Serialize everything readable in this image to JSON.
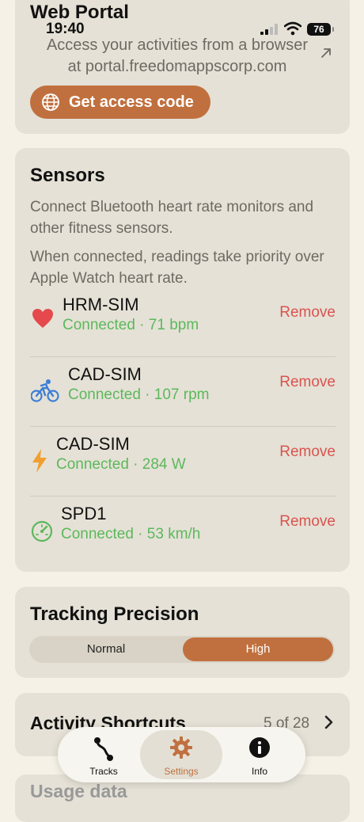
{
  "status_bar": {
    "time": "19:40",
    "battery": "76"
  },
  "web_portal": {
    "title": "Web Portal",
    "description_line1": "Access your activities from a browser",
    "description_line2": "at portal.freedomappscorp.com",
    "button_label": "Get access code"
  },
  "sensors": {
    "title": "Sensors",
    "desc1": "Connect Bluetooth heart rate monitors and other fitness sensors.",
    "desc2": "When connected, readings take priority over Apple Watch heart rate.",
    "items": [
      {
        "icon": "heart-icon",
        "name": "HRM-SIM",
        "status": "Connected · 71 bpm",
        "action": "Remove",
        "color": "#e5484d"
      },
      {
        "icon": "cyclist-icon",
        "name": "CAD-SIM",
        "status": "Connected · 107 rpm",
        "action": "Remove",
        "color": "#3d7fd6"
      },
      {
        "icon": "bolt-icon",
        "name": "CAD-SIM",
        "status": "Connected · 284 W",
        "action": "Remove",
        "color": "#f0a030"
      },
      {
        "icon": "speedometer-icon",
        "name": "SPD1",
        "status": "Connected · 53 km/h",
        "action": "Remove",
        "color": "#5cb85c"
      }
    ]
  },
  "tracking_precision": {
    "title": "Tracking Precision",
    "options": [
      "Normal",
      "High"
    ],
    "selected": "High"
  },
  "activity_shortcuts": {
    "title": "Activity Shortcuts",
    "count": "5 of 28"
  },
  "usage": {
    "title": "Usage data"
  },
  "tab_bar": {
    "tabs": [
      {
        "label": "Tracks",
        "icon": "route-icon"
      },
      {
        "label": "Settings",
        "icon": "gear-icon",
        "selected": true
      },
      {
        "label": "Info",
        "icon": "info-icon"
      }
    ]
  },
  "colors": {
    "accent": "#c0703e",
    "connected": "#5cb85c",
    "remove": "#d9534f",
    "card": "#e5e1d6",
    "background": "#f5f1e6"
  }
}
